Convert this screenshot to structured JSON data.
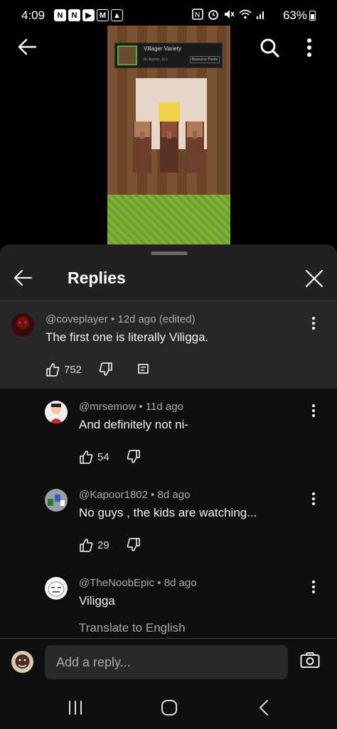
{
  "status_bar": {
    "time": "4:09",
    "notification_icons": [
      "N",
      "N",
      "yt",
      "M",
      "img"
    ],
    "battery_percent": "63%"
  },
  "video": {
    "overlay": {
      "title": "Villager Variety",
      "subtitle": "By Agente_511",
      "tag": "Resource Packs"
    }
  },
  "sheet": {
    "title": "Replies",
    "parent_comment": {
      "author_meta": "@coveplayer • 12d ago (edited)",
      "text": "The first one is literally Viligga.",
      "likes": "752"
    },
    "replies": [
      {
        "author_meta": "@mrsemow • 11d ago",
        "text": "And definitely not ni-",
        "likes": "54"
      },
      {
        "author_meta": "@Kapoor1802 • 8d ago",
        "text": "No guys , the kids are watching...",
        "likes": "29"
      },
      {
        "author_meta": "@TheNoobEpic • 8d ago",
        "text": "Viligga",
        "likes": ""
      }
    ],
    "translate_label": "Translate to English"
  },
  "reply_bar": {
    "placeholder": "Add a reply..."
  },
  "colors": {
    "sheet_bg": "#212121",
    "highlight_bg": "#272727",
    "list_bg": "#0f0f0f",
    "secondary_text": "#aaaaaa"
  }
}
